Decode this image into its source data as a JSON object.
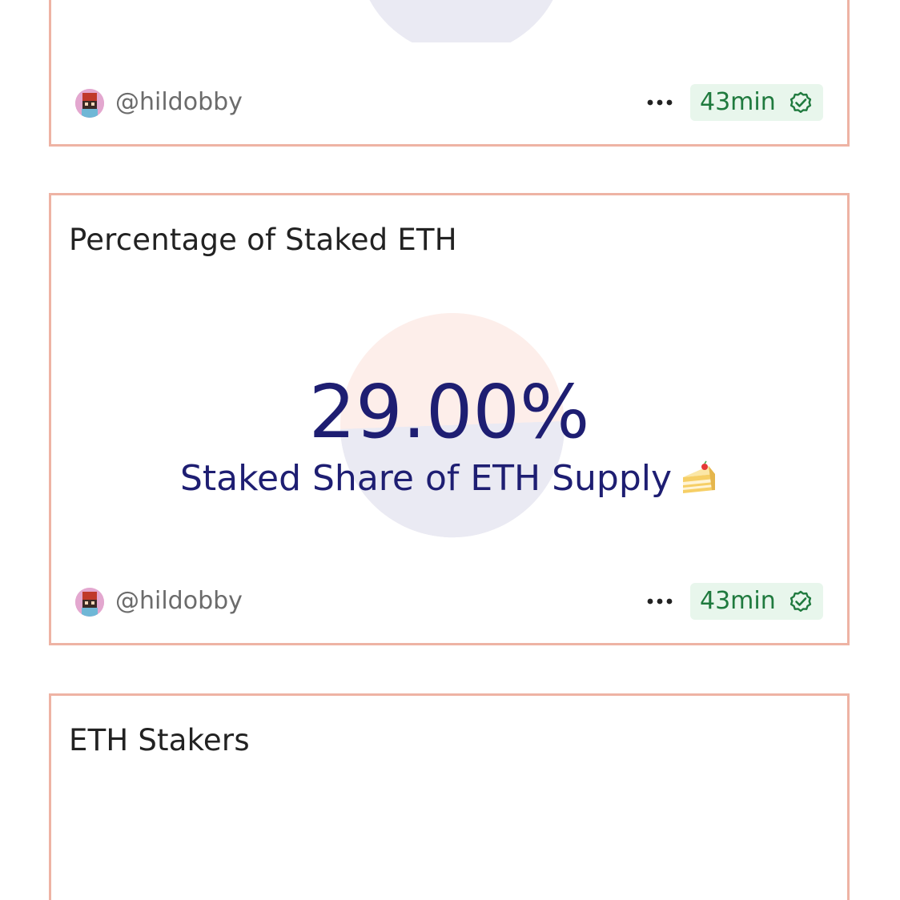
{
  "cards": [
    {
      "title": "",
      "author": "@hildobby",
      "time": "43min"
    },
    {
      "title": "Percentage of Staked ETH",
      "value": "29.00%",
      "label": "Staked Share of ETH Supply",
      "label_emoji": "cake-icon",
      "author": "@hildobby",
      "time": "43min"
    },
    {
      "title": "ETH Stakers"
    }
  ],
  "colors": {
    "card_border": "#eeb3a4",
    "value_text": "#1e1e72",
    "badge_bg": "#e8f6ec",
    "badge_text": "#1f7a3e",
    "pie_light": "#eaeaf3",
    "pie_pink": "#fdeeea"
  },
  "icons": {
    "more": "more-horizontal-icon",
    "verified": "verified-check-icon",
    "avatar": "avatar"
  }
}
